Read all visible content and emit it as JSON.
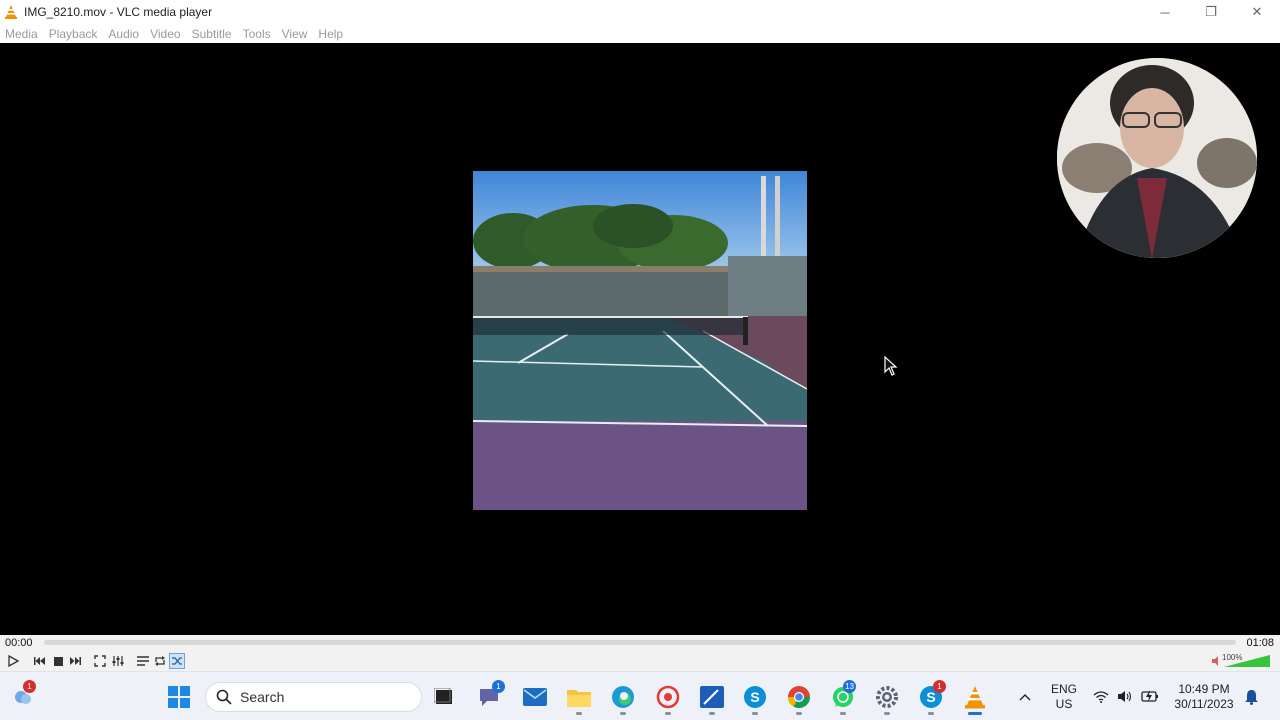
{
  "window": {
    "title": "IMG_8210.mov - VLC media player",
    "controls": {
      "minimize": "─",
      "maximize": "❐",
      "close": "✕"
    }
  },
  "menu": {
    "items": [
      "Media",
      "Playback",
      "Audio",
      "Video",
      "Subtitle",
      "Tools",
      "View",
      "Help"
    ]
  },
  "player": {
    "elapsed": "00:00",
    "duration": "01:08",
    "progress_fraction": 0.0,
    "volume_label": "100%",
    "volume_fraction": 1.0,
    "shuffle_active": true
  },
  "colors": {
    "vlc_orange": "#f39200",
    "accent_blue": "#1e6fd9",
    "badge_red": "#d32f2f"
  },
  "taskbar": {
    "search_placeholder": "Search",
    "badges": {
      "widgets": "1",
      "teams": "1",
      "whatsapp": "13",
      "skype": "1"
    },
    "tray": {
      "lang_line1": "ENG",
      "lang_line2": "US",
      "time": "10:49 PM",
      "date": "30/11/2023"
    }
  }
}
